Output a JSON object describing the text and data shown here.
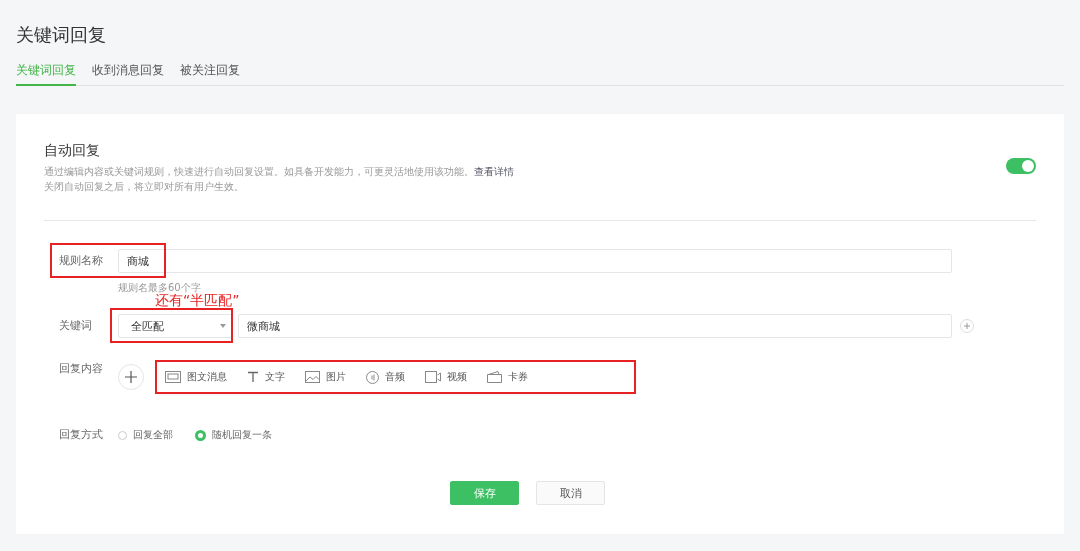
{
  "page_title": "关键词回复",
  "tabs": [
    {
      "label": "关键词回复",
      "selected": true
    },
    {
      "label": "收到消息回复",
      "selected": false
    },
    {
      "label": "被关注回复",
      "selected": false
    }
  ],
  "auto_reply": {
    "title": "自动回复",
    "description": "通过编辑内容或关键词规则，快速进行自动回复设置。如具备开发能力，可更灵活地使用该功能。",
    "link": "查看详情",
    "note": "关闭自动回复之后，将立即对所有用户生效。",
    "on": true
  },
  "form": {
    "rule_name": {
      "label": "规则名称",
      "value": "商城",
      "hint": "规则名最多60个字"
    },
    "keyword": {
      "label": "关键词",
      "match": "全匹配",
      "value": "微商城"
    },
    "reply_content": {
      "label": "回复内容",
      "types": [
        {
          "kind": "news",
          "label": "图文消息"
        },
        {
          "kind": "text",
          "label": "文字"
        },
        {
          "kind": "image",
          "label": "图片"
        },
        {
          "kind": "audio",
          "label": "音频"
        },
        {
          "kind": "video",
          "label": "视频"
        },
        {
          "kind": "card",
          "label": "卡券"
        }
      ]
    },
    "reply_mode": {
      "label": "回复方式",
      "options": [
        {
          "label": "回复全部",
          "selected": false
        },
        {
          "label": "随机回复一条",
          "selected": true
        }
      ]
    }
  },
  "buttons": [
    {
      "kind": "primary",
      "label": "保存"
    },
    {
      "kind": "default",
      "label": "取消"
    }
  ],
  "annotation": {
    "text": "还有“半匹配”"
  }
}
